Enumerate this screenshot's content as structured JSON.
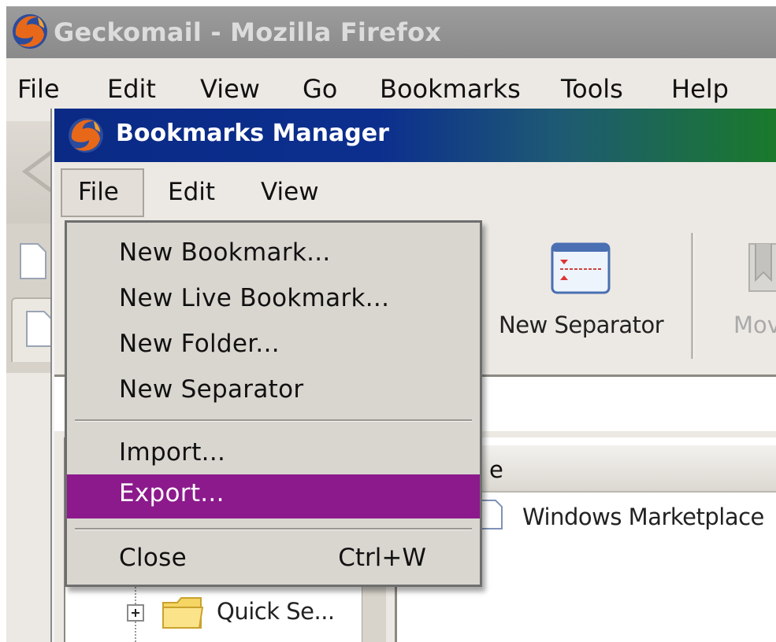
{
  "firefox": {
    "title": "Geckomail - Mozilla Firefox",
    "menu": [
      "File",
      "Edit",
      "View",
      "Go",
      "Bookmarks",
      "Tools",
      "Help"
    ]
  },
  "bookmarks_manager": {
    "title": "Bookmarks Manager",
    "menu": [
      "File",
      "Edit",
      "View"
    ],
    "toolbar": {
      "new_separator_label": "New Separator",
      "move_label": "Mov"
    },
    "list": {
      "header": "e",
      "items": [
        "Windows Marketplace"
      ]
    },
    "tree": {
      "items": [
        "Quick Se..."
      ]
    }
  },
  "file_menu": {
    "items": [
      {
        "label": "New Bookmark...",
        "shortcut": ""
      },
      {
        "label": "New Live Bookmark...",
        "shortcut": ""
      },
      {
        "label": "New Folder...",
        "shortcut": ""
      },
      {
        "label": "New Separator",
        "shortcut": ""
      },
      {
        "label": "Import...",
        "shortcut": ""
      },
      {
        "label": "Export...",
        "shortcut": "",
        "highlighted": true
      },
      {
        "label": "Close",
        "shortcut": "Ctrl+W"
      }
    ]
  },
  "colors": {
    "highlight": "#8c1a8c",
    "bm_title_gradient_start": "#0a2a85",
    "bm_title_gradient_end": "#1a7a2a"
  }
}
